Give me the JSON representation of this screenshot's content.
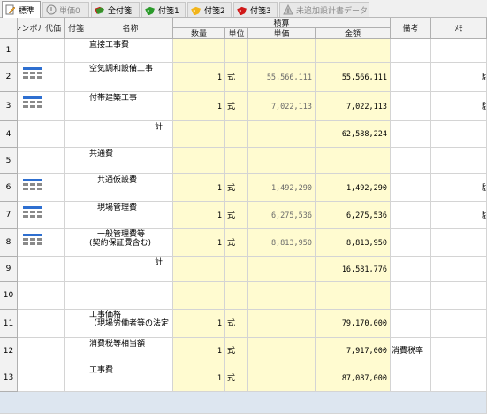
{
  "tabs": [
    {
      "label": "標準",
      "icon": "pencil-icon",
      "state": "active"
    },
    {
      "label": "単価0",
      "icon": "exclamation-circle-icon",
      "state": "disabled"
    },
    {
      "label": "全付箋",
      "icon": "tags-icon",
      "state": "normal"
    },
    {
      "label": "付箋1",
      "icon": "green-tag-icon",
      "state": "normal"
    },
    {
      "label": "付箋2",
      "icon": "yellow-tag-icon",
      "state": "normal"
    },
    {
      "label": "付箋3",
      "icon": "red-tag-icon",
      "state": "normal"
    },
    {
      "label": "未追加設計書データ",
      "icon": "warning-icon",
      "state": "disabled"
    }
  ],
  "colors": {
    "accent": "#2e6fd0",
    "highlight": "#fffbd0",
    "tag_green": "#2a9a2a",
    "tag_yellow": "#f2b418",
    "tag_red": "#d01818",
    "tag_blue": "#2e6fd0"
  },
  "headers": {
    "symbol": "シンボル",
    "proxy": "代価",
    "sticky": "付箋",
    "name": "名称",
    "estimate_group": "積算",
    "qty": "数量",
    "unit": "単位",
    "unit_price": "単価",
    "amount": "金額",
    "remarks": "備考",
    "memo": "ﾒﾓ"
  },
  "rows": [
    {
      "no": "1",
      "name": "直接工事費",
      "name_indent": 0,
      "qty": "",
      "unit": "",
      "unit_price": "",
      "amount": "",
      "remarks": "",
      "memo": "",
      "symbol": false
    },
    {
      "no": "2",
      "name": "空気調和設備工事",
      "name_indent": 0,
      "qty": "1",
      "unit": "式",
      "unit_price": "55,566,111",
      "amount": "55,566,111",
      "remarks": "",
      "memo": "駐",
      "symbol": true
    },
    {
      "no": "3",
      "name": "付帯建築工事",
      "name_indent": 0,
      "qty": "1",
      "unit": "式",
      "unit_price": "7,022,113",
      "amount": "7,022,113",
      "remarks": "",
      "memo": "駐",
      "symbol": true
    },
    {
      "no": "4",
      "name": "計",
      "name_indent": 2,
      "qty": "",
      "unit": "",
      "unit_price": "",
      "amount": "62,588,224",
      "remarks": "",
      "memo": "",
      "symbol": false
    },
    {
      "no": "5",
      "name": "共通費",
      "name_indent": 0,
      "qty": "",
      "unit": "",
      "unit_price": "",
      "amount": "",
      "remarks": "",
      "memo": "",
      "symbol": false
    },
    {
      "no": "6",
      "name": "共通仮設費",
      "name_indent": 1,
      "qty": "1",
      "unit": "式",
      "unit_price": "1,492,290",
      "amount": "1,492,290",
      "remarks": "",
      "memo": "駐",
      "symbol": true
    },
    {
      "no": "7",
      "name": "現場管理費",
      "name_indent": 1,
      "qty": "1",
      "unit": "式",
      "unit_price": "6,275,536",
      "amount": "6,275,536",
      "remarks": "",
      "memo": "駐",
      "symbol": true
    },
    {
      "no": "8",
      "name": "一般管理費等",
      "name2": "(契約保証費含む)",
      "name_indent": 1,
      "qty": "1",
      "unit": "式",
      "unit_price": "8,813,950",
      "amount": "8,813,950",
      "remarks": "",
      "memo": "",
      "symbol": true
    },
    {
      "no": "9",
      "name": "計",
      "name_indent": 2,
      "qty": "",
      "unit": "",
      "unit_price": "",
      "amount": "16,581,776",
      "remarks": "",
      "memo": "",
      "symbol": false
    },
    {
      "no": "10",
      "name": "",
      "name_indent": 0,
      "qty": "",
      "unit": "",
      "unit_price": "",
      "amount": "",
      "remarks": "",
      "memo": "",
      "symbol": false
    },
    {
      "no": "11",
      "name": "工事価格",
      "name2": "（現場労働者等の法定",
      "name_indent": 0,
      "qty": "1",
      "unit": "式",
      "unit_price": "",
      "amount": "79,170,000",
      "remarks": "",
      "memo": "",
      "symbol": false
    },
    {
      "no": "12",
      "name": "消費税等相当額",
      "name_indent": 0,
      "qty": "1",
      "unit": "式",
      "unit_price": "",
      "amount": "7,917,000",
      "remarks": "消費税率",
      "memo": "",
      "symbol": false
    },
    {
      "no": "13",
      "name": "工事費",
      "name_indent": 0,
      "qty": "1",
      "unit": "式",
      "unit_price": "",
      "amount": "87,087,000",
      "remarks": "",
      "memo": "",
      "symbol": false
    }
  ]
}
